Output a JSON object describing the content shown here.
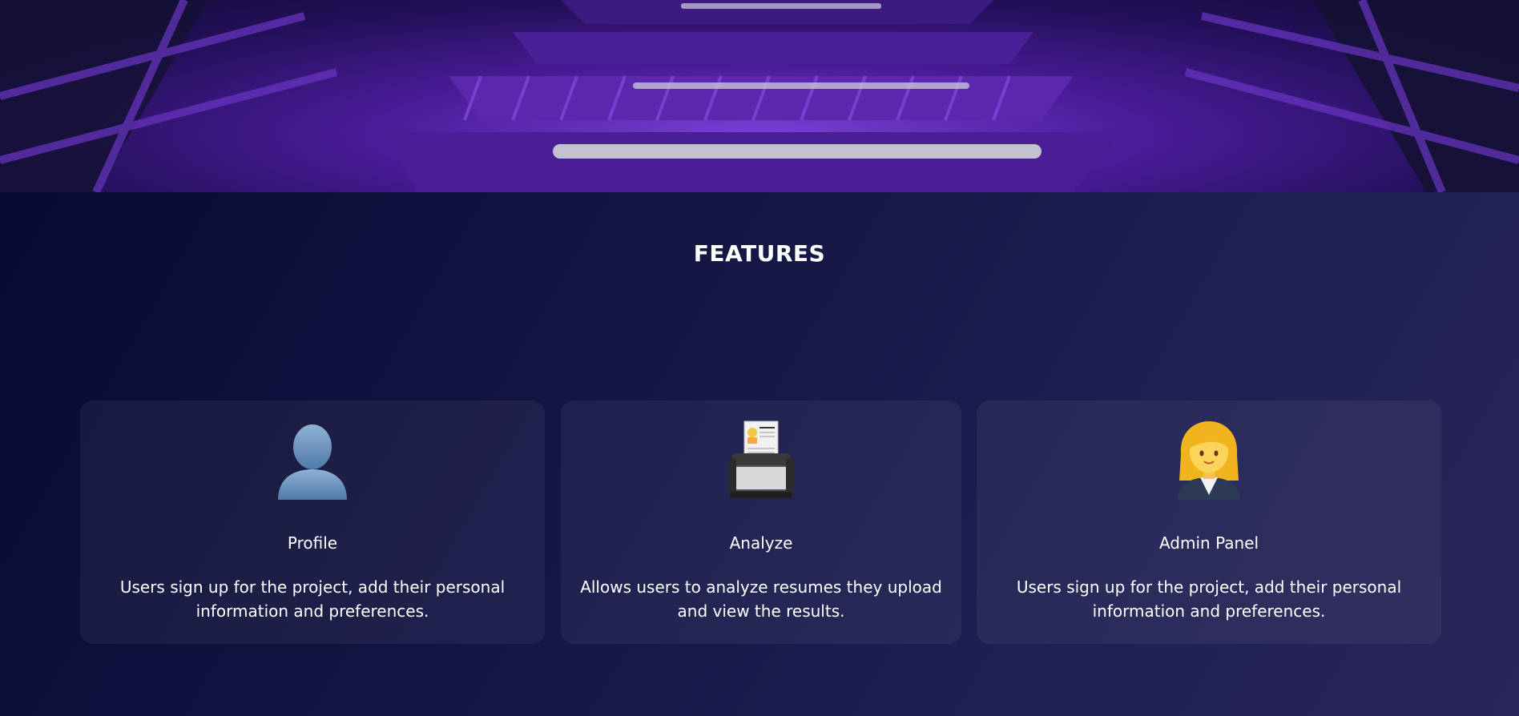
{
  "features": {
    "title": "FEATURES",
    "cards": [
      {
        "icon": "silhouette-person-icon",
        "title": "Profile",
        "description": "Users sign up for the project, add their personal information and preferences."
      },
      {
        "icon": "resume-scanner-icon",
        "title": "Analyze",
        "description": "Allows users to analyze resumes they upload and view the results."
      },
      {
        "icon": "woman-office-worker-icon",
        "title": "Admin Panel",
        "description": "Users sign up for the project, add their personal information and preferences."
      }
    ]
  },
  "colors": {
    "background_start": "#06082f",
    "background_end": "#2a2559",
    "hero_accent": "#7b3fd6",
    "card_background": "rgba(255,255,255,0.05)",
    "text": "#ffffff"
  }
}
